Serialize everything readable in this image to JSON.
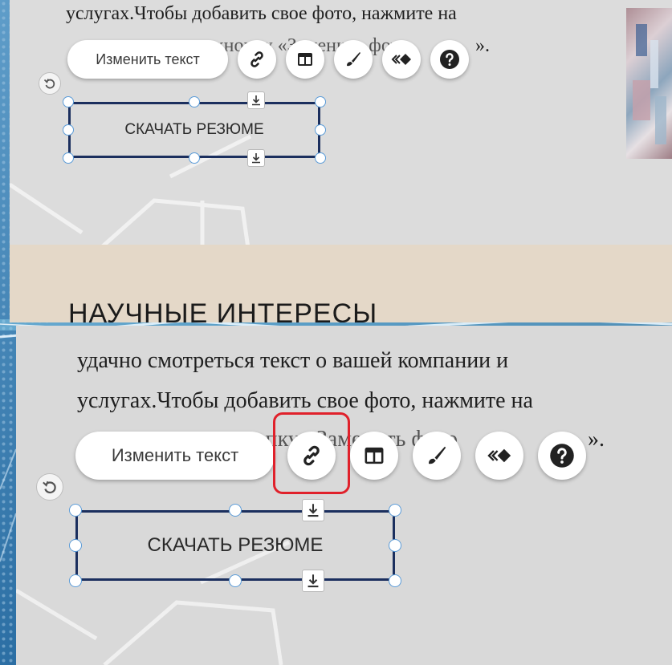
{
  "editor": {
    "body_line_1": "услугах.Чтобы добавить свое фото, нажмите на",
    "body_line_1_tail": "».",
    "body_hidden_1": "кнопку «Заменить фото",
    "heading": "НАУЧНЫЕ ИНТЕРЕСЫ",
    "body_top_2": "удачно смотреться текст о вашей компании и",
    "body_line_2": "услугах.Чтобы добавить свое фото, нажмите на",
    "body_line_2_tail": "».",
    "body_hidden_2": "кнопку «Заменить фото"
  },
  "toolbar": {
    "edit_text_label": "Изменить текст",
    "link_icon": "link-icon",
    "layout_icon": "layout-icon",
    "design_icon": "brush-icon",
    "animation_icon": "animation-icon",
    "help_icon": "help-icon",
    "rotate_icon": "rotate-icon"
  },
  "button": {
    "label": "СКАЧАТЬ РЕЗЮМЕ",
    "anchor_icon": "download-anchor-icon"
  },
  "colors": {
    "selection_border": "#1b2f5e",
    "handle_border": "#5a9bd8",
    "highlight": "#e0212b",
    "beige_band": "#e4d8c8",
    "panel_bg": "#dcdcdc",
    "outer_bg": "#2d74a6"
  }
}
